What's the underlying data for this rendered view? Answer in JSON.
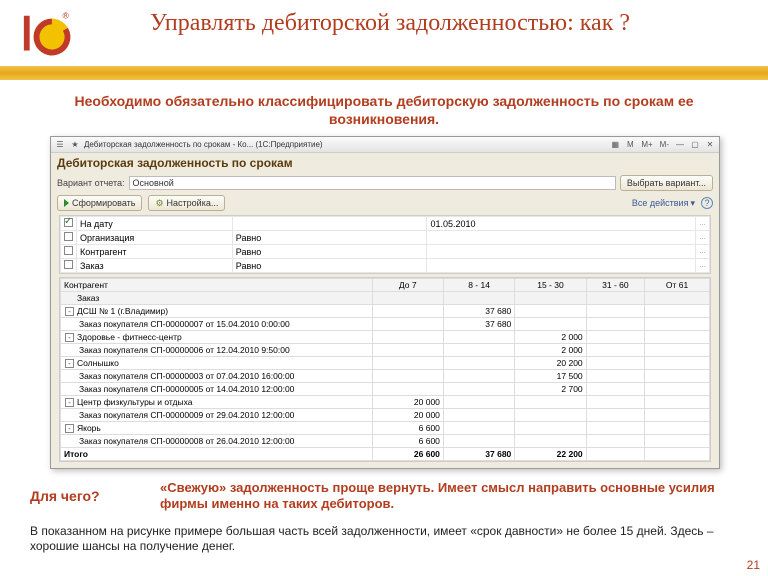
{
  "slide": {
    "title": "Управлять дебиторской задолженностью: как ?",
    "subtitle": "Необходимо обязательно классифицировать дебиторскую задолженность по срокам ее возникновения.",
    "for_what_label": "Для чего?",
    "answer": "«Свежую» задолженность проще вернуть. Имеет смысл направить основные усилия фирмы именно на таких дебиторов.",
    "note": "В показанном на рисунке примере большая часть всей задолженности, имеет «срок давности» не более 15 дней. Здесь – хорошие шансы на получение денег.",
    "page": "21"
  },
  "win": {
    "title": "Дебиторская задолженность по срокам - Ко... (1С:Предприятие)",
    "mini_btns": [
      "M",
      "M+",
      "M-"
    ],
    "report_title": "Дебиторская задолженность по срокам",
    "variant_label": "Вариант отчета:",
    "variant_value": "Основной",
    "choose_variant": "Выбрать вариант...",
    "form_btn": "Сформировать",
    "settings_btn": "Настройка...",
    "all_actions": "Все действия",
    "params": [
      {
        "checked": true,
        "name": "На дату",
        "op": "",
        "val": "01.05.2010"
      },
      {
        "checked": false,
        "name": "Организация",
        "op": "Равно",
        "val": ""
      },
      {
        "checked": false,
        "name": "Контрагент",
        "op": "Равно",
        "val": ""
      },
      {
        "checked": false,
        "name": "Заказ",
        "op": "Равно",
        "val": ""
      }
    ],
    "columns": [
      "Контрагент",
      "До 7",
      "8 - 14",
      "15 - 30",
      "31 - 60",
      "От 61"
    ],
    "sub_header": "Заказ",
    "rows": [
      {
        "lvl": 0,
        "t": "-",
        "name": "ДСШ № 1 (г.Владимир)",
        "v": [
          "",
          "37 680",
          "",
          "",
          ""
        ]
      },
      {
        "lvl": 1,
        "t": "",
        "name": "Заказ покупателя СП-00000007 от 15.04.2010 0:00:00",
        "v": [
          "",
          "37 680",
          "",
          "",
          ""
        ]
      },
      {
        "lvl": 0,
        "t": "-",
        "name": "Здоровье - фитнесс-центр",
        "v": [
          "",
          "",
          "2 000",
          "",
          ""
        ]
      },
      {
        "lvl": 1,
        "t": "",
        "name": "Заказ покупателя СП-00000006 от 12.04.2010 9:50:00",
        "v": [
          "",
          "",
          "2 000",
          "",
          ""
        ]
      },
      {
        "lvl": 0,
        "t": "-",
        "name": "Солнышко",
        "v": [
          "",
          "",
          "20 200",
          "",
          ""
        ]
      },
      {
        "lvl": 1,
        "t": "",
        "name": "Заказ покупателя СП-00000003 от 07.04.2010 16:00:00",
        "v": [
          "",
          "",
          "17 500",
          "",
          ""
        ]
      },
      {
        "lvl": 1,
        "t": "",
        "name": "Заказ покупателя СП-00000005 от 14.04.2010 12:00:00",
        "v": [
          "",
          "",
          "2 700",
          "",
          ""
        ]
      },
      {
        "lvl": 0,
        "t": "-",
        "name": "Центр физкультуры и отдыха",
        "v": [
          "20 000",
          "",
          "",
          "",
          ""
        ]
      },
      {
        "lvl": 1,
        "t": "",
        "name": "Заказ покупателя СП-00000009 от 29.04.2010 12:00:00",
        "v": [
          "20 000",
          "",
          "",
          "",
          ""
        ]
      },
      {
        "lvl": 0,
        "t": "-",
        "name": "Якорь",
        "v": [
          "6 600",
          "",
          "",
          "",
          ""
        ]
      },
      {
        "lvl": 1,
        "t": "",
        "name": "Заказ покупателя СП-00000008 от 26.04.2010 12:00:00",
        "v": [
          "6 600",
          "",
          "",
          "",
          ""
        ]
      }
    ],
    "total_label": "Итого",
    "totals": [
      "26 600",
      "37 680",
      "22 200",
      "",
      ""
    ]
  }
}
